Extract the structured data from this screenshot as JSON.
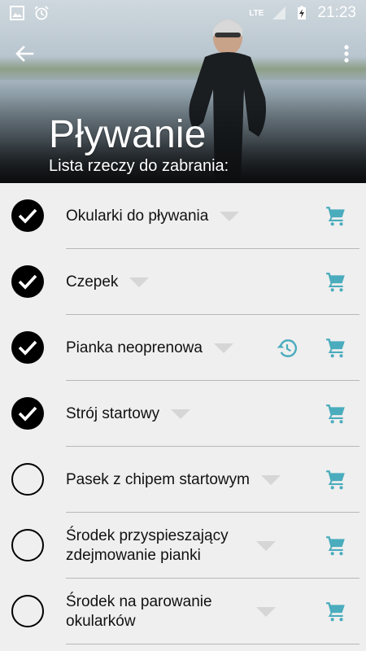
{
  "statusbar": {
    "time": "21:23",
    "network_label": "LTE",
    "icons": [
      "image-icon",
      "alarm-icon",
      "signal-icon",
      "battery-charging-icon"
    ]
  },
  "toolbar": {
    "back_icon": "arrow-back-icon",
    "overflow_icon": "more-vert-icon"
  },
  "header": {
    "title": "Pływanie",
    "subtitle": "Lista rzeczy do zabrania:"
  },
  "colors": {
    "accent": "#4aacbd",
    "check": "#000000",
    "divider": "#b8b8b8",
    "background": "#efefef"
  },
  "items": [
    {
      "label": "Okularki do pływania",
      "checked": true,
      "has_history": false
    },
    {
      "label": "Czepek",
      "checked": true,
      "has_history": false
    },
    {
      "label": "Pianka neoprenowa",
      "checked": true,
      "has_history": true
    },
    {
      "label": "Strój startowy",
      "checked": true,
      "has_history": false
    },
    {
      "label": "Pasek z chipem startowym",
      "checked": false,
      "has_history": false
    },
    {
      "label": "Środek przyspieszający zdejmowanie pianki",
      "checked": false,
      "has_history": false
    },
    {
      "label": "Środek na parowanie okularków",
      "checked": false,
      "has_history": false
    }
  ]
}
